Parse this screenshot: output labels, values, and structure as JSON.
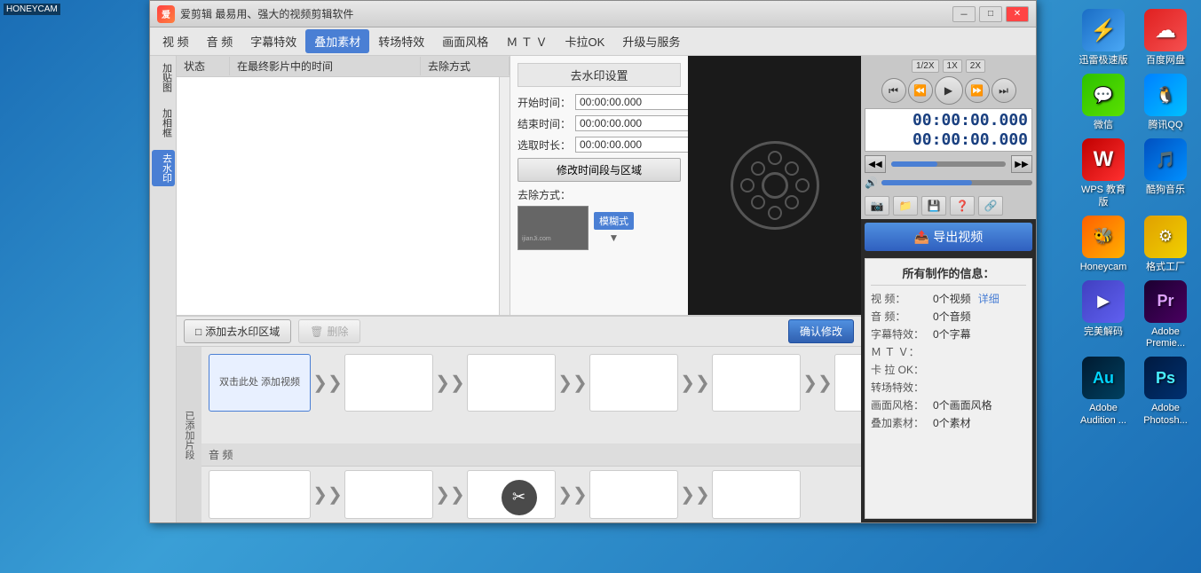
{
  "app": {
    "title": "爱剪辑  最易用、强大的视频剪辑软件",
    "icon_label": "爱",
    "window_controls": [
      "－",
      "□",
      "✕"
    ]
  },
  "menu": {
    "items": [
      "视  频",
      "音  频",
      "字幕特效",
      "叠加素材",
      "转场特效",
      "画面风格",
      "Ｍ Ｔ Ｖ",
      "卡拉OK",
      "升级与服务"
    ],
    "active_index": 3
  },
  "sidebar": {
    "buttons": [
      "加\n贴\n图",
      "加\n相\n框",
      "去\n水\n印"
    ]
  },
  "table": {
    "headers": [
      "状态",
      "在最终影片中的时间",
      "去除方式"
    ],
    "rows": []
  },
  "watermark_settings": {
    "title": "去水印设置",
    "start_label": "开始时间：",
    "start_value": "00:00:00.000",
    "end_label": "结束时间：",
    "end_value": "00:00:00.000",
    "duration_label": "选取时长：",
    "duration_value": "00:00:00.000",
    "modify_btn": "修改时间段与区域",
    "removal_label": "去除方式：",
    "removal_options": [
      "模糊式"
    ],
    "preview_text": "ijianJi.com"
  },
  "action_bar": {
    "add_btn": "添加去水印区域",
    "delete_btn": "删除",
    "confirm_btn": "确认修改"
  },
  "player": {
    "speeds": [
      "1/2X",
      "1X",
      "2X"
    ],
    "time1": "00:00:00.000",
    "time2": "00:00:00.000",
    "export_btn": "导出视频"
  },
  "toolbar": {
    "icons": [
      "🎬",
      "📁",
      "💾",
      "❓",
      "🔗"
    ]
  },
  "info": {
    "title": "所有制作的信息：",
    "rows": [
      {
        "key": "视  频：",
        "val": "0个视频",
        "link": "详细"
      },
      {
        "key": "音  频：",
        "val": "0个音频",
        "link": ""
      },
      {
        "key": "字幕特效：",
        "val": "0个字幕",
        "link": ""
      },
      {
        "key": "Ｍ Ｔ Ｖ：",
        "val": "",
        "link": ""
      },
      {
        "key": "卡 拉 OK：",
        "val": "",
        "link": ""
      },
      {
        "key": "转场特效：",
        "val": "",
        "link": ""
      },
      {
        "key": "画面风格：",
        "val": "0个画面风格",
        "link": ""
      },
      {
        "key": "叠加素材：",
        "val": "0个素材",
        "link": ""
      }
    ]
  },
  "timeline": {
    "already_added": "已\n添\n加\n片\n段",
    "video_block": {
      "text": "双击此处\n添加视频"
    },
    "audio_label": "音  频",
    "scissors": "✂"
  },
  "desktop": {
    "honeycam_label": "HONEYCAM",
    "icons": [
      {
        "label": "迅雷极速版",
        "color1": "#1a6dc5",
        "color2": "#4aa8f5",
        "symbol": "⚡"
      },
      {
        "label": "百度网盘",
        "color1": "#e02020",
        "color2": "#f55050",
        "symbol": "☁"
      },
      {
        "label": "微信",
        "color1": "#2dc100",
        "color2": "#5ae000",
        "symbol": "💬"
      },
      {
        "label": "腾讯QQ",
        "color1": "#0080ff",
        "color2": "#00c0ff",
        "symbol": "🐧"
      },
      {
        "label": "WPS 教育版",
        "color1": "#c00000",
        "color2": "#ff3030",
        "symbol": "W"
      },
      {
        "label": "酷狗音乐",
        "color1": "#0050c0",
        "color2": "#0090ff",
        "symbol": "🎵"
      },
      {
        "label": "Honeycam",
        "color1": "#ff6000",
        "color2": "#ffb000",
        "symbol": "🐝"
      },
      {
        "label": "格式工厂",
        "color1": "#e0a000",
        "color2": "#f0d000",
        "symbol": "⚙"
      },
      {
        "label": "完美解码",
        "color1": "#4040c0",
        "color2": "#6060f0",
        "symbol": "▶"
      },
      {
        "label": "Adobe Premie...",
        "color1": "#1a0030",
        "color2": "#4a0060",
        "symbol": "Pr"
      },
      {
        "label": "Adobe Audition ...",
        "color1": "#001a30",
        "color2": "#004060",
        "symbol": "Au"
      },
      {
        "label": "Adobe Photosh...",
        "color1": "#001a40",
        "color2": "#003070",
        "symbol": "Ps"
      }
    ]
  }
}
